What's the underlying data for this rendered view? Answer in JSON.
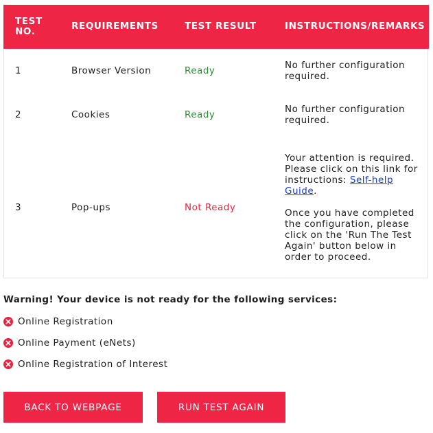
{
  "table": {
    "headers": {
      "test_no": "TEST NO.",
      "requirements": "REQUIREMENTS",
      "test_result": "TEST RESULT",
      "instructions": "INSTRUCTIONS/REMARKS"
    },
    "rows": [
      {
        "no": "1",
        "requirement": "Browser Version",
        "result": "Ready",
        "remarks": "No further configuration required."
      },
      {
        "no": "2",
        "requirement": "Cookies",
        "result": "Ready",
        "remarks": "No further configuration required."
      },
      {
        "no": "3",
        "requirement": "Pop-ups",
        "result": "Not Ready",
        "remarks_before_link": "Your attention is required. Please click on this link for instructions: ",
        "link_text": "Self-help Guide",
        "remarks_after_link": ".",
        "remarks_followup": "Once you have completed the configuration, please click on the 'Run The Test Again' button below in order to proceed."
      }
    ]
  },
  "warning": {
    "text": "Warning! Your device is not ready for the following services:"
  },
  "services": [
    {
      "label": "Online Registration",
      "icon": "error-x-icon"
    },
    {
      "label": "Online Payment (eNets)",
      "icon": "error-x-icon"
    },
    {
      "label": "Online Registration of Interest",
      "icon": "error-x-icon"
    }
  ],
  "buttons": {
    "back_label": "BACK TO WEBPAGE",
    "run_label": "RUN TEST AGAIN"
  },
  "colors": {
    "accent": "#ef2546",
    "ready": "#2e8b2e",
    "not_ready": "#e8233f",
    "link": "#1a3ccc"
  }
}
